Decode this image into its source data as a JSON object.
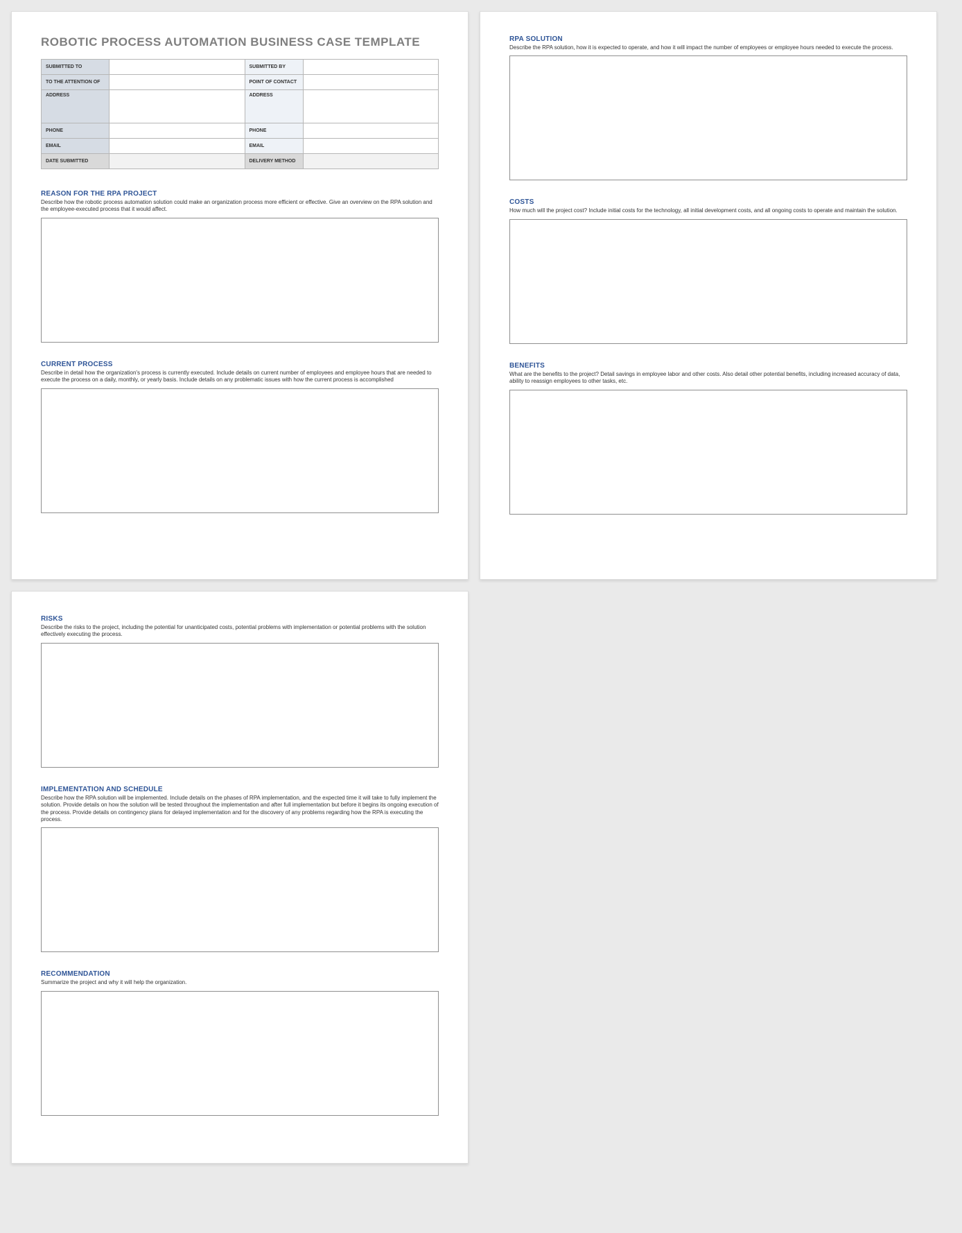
{
  "doc": {
    "title": "ROBOTIC PROCESS AUTOMATION BUSINESS CASE TEMPLATE"
  },
  "header": {
    "rows": [
      {
        "la": "SUBMITTED TO",
        "va": "",
        "lb": "SUBMITTED BY",
        "vb": ""
      },
      {
        "la": "TO THE ATTENTION OF",
        "va": "",
        "lb": "POINT OF CONTACT",
        "vb": ""
      },
      {
        "la": "ADDRESS",
        "va": "",
        "lb": "ADDRESS",
        "vb": "",
        "addr": true
      },
      {
        "la": "PHONE",
        "va": "",
        "lb": "PHONE",
        "vb": ""
      },
      {
        "la": "EMAIL",
        "va": "",
        "lb": "EMAIL",
        "vb": ""
      },
      {
        "la": "DATE SUBMITTED",
        "va": "",
        "lb": "DELIVERY METHOD",
        "vb": "",
        "footer": true
      }
    ]
  },
  "sections": {
    "reason": {
      "title": "REASON FOR THE RPA PROJECT",
      "desc": "Describe how the robotic process automation solution could make an organization process more efficient or effective. Give an overview on the RPA solution and the employee-executed process that it would affect."
    },
    "current": {
      "title": "CURRENT PROCESS",
      "desc": "Describe in detail how the organization's process is currently executed. Include details on current number of employees and employee hours that are needed to execute the process on a daily, monthly, or yearly basis. Include details on any problematic issues with how the current process is accomplished"
    },
    "solution": {
      "title": "RPA SOLUTION",
      "desc": "Describe the RPA solution, how it is expected to operate, and how it will impact the number of employees or employee hours needed to execute the process."
    },
    "costs": {
      "title": "COSTS",
      "desc": "How much will the project cost? Include initial costs for the technology, all initial development costs, and all ongoing costs to operate and maintain the solution."
    },
    "benefits": {
      "title": "BENEFITS",
      "desc": "What are the benefits to the project? Detail savings in employee labor and other costs. Also detail other potential benefits, including increased accuracy of data, ability to reassign employees to other tasks, etc."
    },
    "risks": {
      "title": "RISKS",
      "desc": "Describe the risks to the project, including the potential for unanticipated costs, potential problems with implementation or potential problems with the solution effectively executing the process."
    },
    "impl": {
      "title": "IMPLEMENTATION AND SCHEDULE",
      "desc": "Describe how the RPA solution will be implemented. Include details on the phases of RPA implementation, and the expected time it will take to fully implement the solution. Provide details on how the solution will be tested throughout the implementation and after full implementation but before it begins its ongoing execution of the process. Provide details on contingency plans for delayed implementation and for the discovery of any problems regarding how the RPA is executing the process."
    },
    "rec": {
      "title": "RECOMMENDATION",
      "desc": "Summarize the project and why it will help the organization."
    }
  }
}
